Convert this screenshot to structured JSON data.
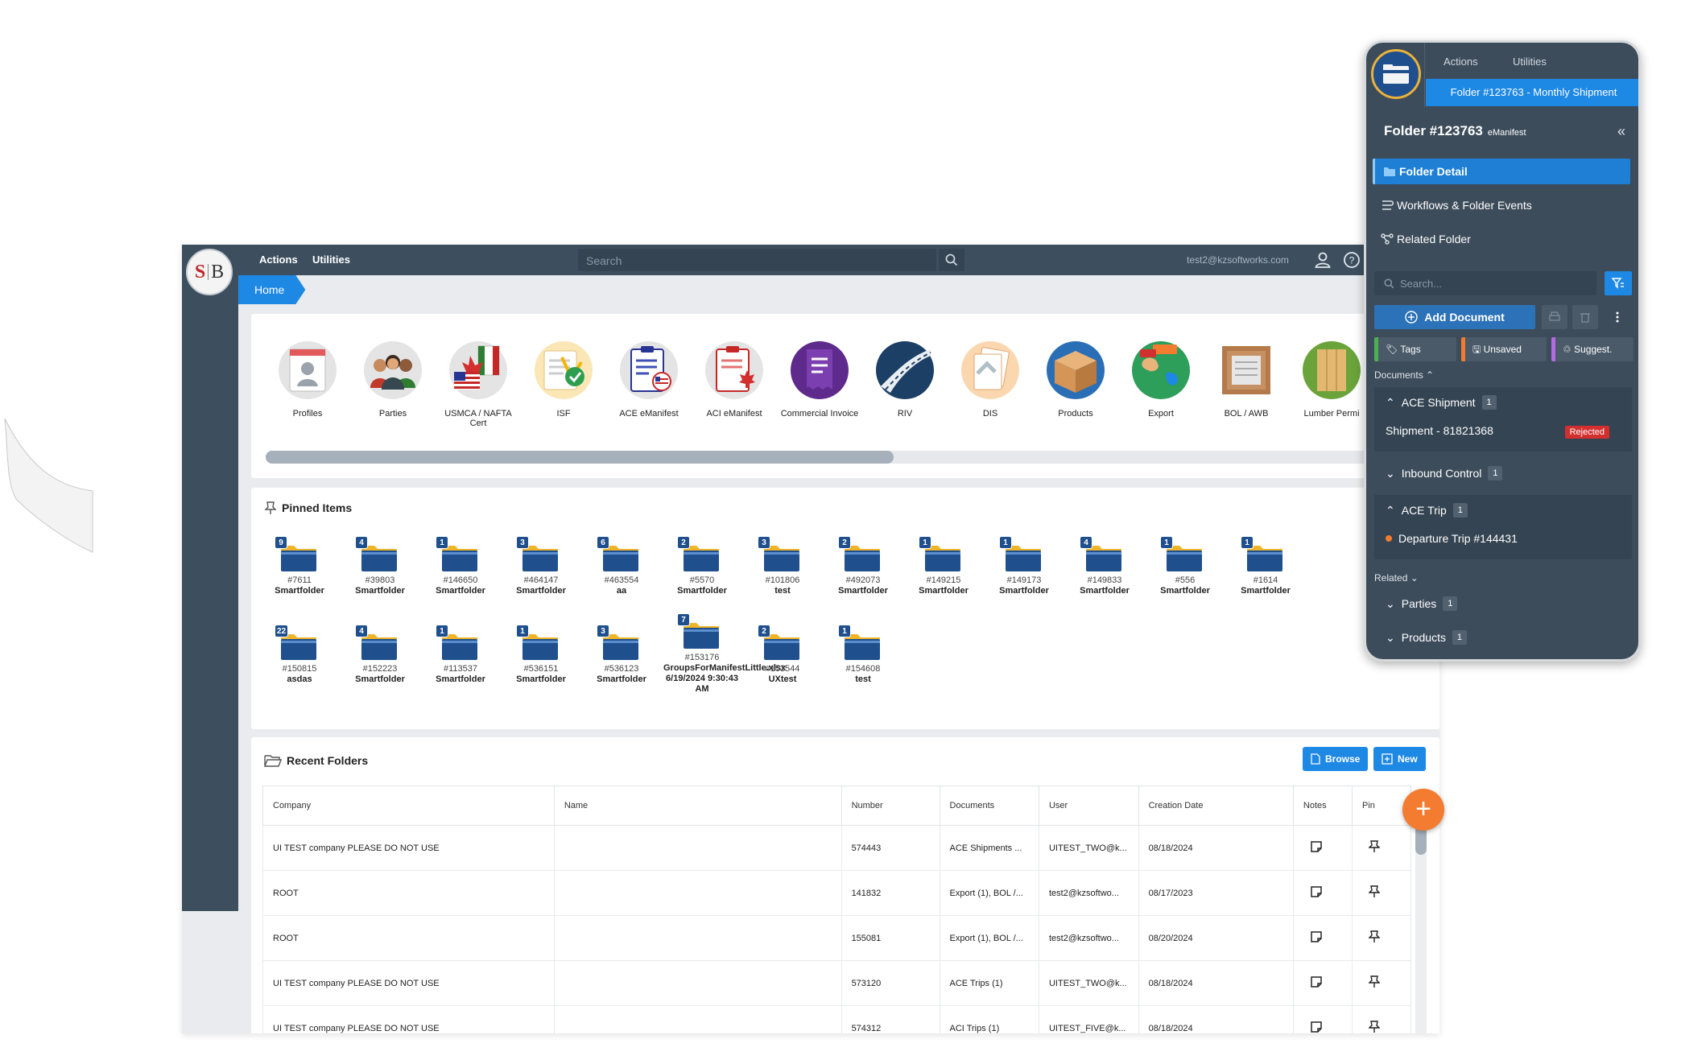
{
  "topbar": {
    "actions_label": "Actions",
    "utilities_label": "Utilities",
    "search_placeholder": "Search",
    "user_email": "test2@kzsoftworks.com"
  },
  "breadcrumb": {
    "home_label": "Home"
  },
  "modules": [
    {
      "label": "Profiles",
      "icon": "profile-card-icon"
    },
    {
      "label": "Parties",
      "icon": "people-group-icon"
    },
    {
      "label": "USMCA / NAFTA Cert",
      "icon": "flags-certificate-icon"
    },
    {
      "label": "ISF",
      "icon": "checked-document-icon"
    },
    {
      "label": "ACE eManifest",
      "icon": "us-manifest-icon"
    },
    {
      "label": "ACI eManifest",
      "icon": "canada-manifest-icon"
    },
    {
      "label": "Commercial Invoice",
      "icon": "invoice-icon"
    },
    {
      "label": "RIV",
      "icon": "road-icon"
    },
    {
      "label": "DIS",
      "icon": "documents-stack-icon"
    },
    {
      "label": "Products",
      "icon": "box-icon"
    },
    {
      "label": "Export",
      "icon": "globe-icon"
    },
    {
      "label": "BOL / AWB",
      "icon": "crate-icon"
    },
    {
      "label": "Lumber Permi",
      "icon": "lumber-icon"
    }
  ],
  "pinned": {
    "title": "Pinned Items",
    "items": [
      {
        "badge": "9",
        "number": "#7611",
        "name": "Smartfolder"
      },
      {
        "badge": "4",
        "number": "#39803",
        "name": "Smartfolder"
      },
      {
        "badge": "1",
        "number": "#146650",
        "name": "Smartfolder"
      },
      {
        "badge": "3",
        "number": "#464147",
        "name": "Smartfolder"
      },
      {
        "badge": "6",
        "number": "#463554",
        "name": "aa"
      },
      {
        "badge": "2",
        "number": "#5570",
        "name": "Smartfolder"
      },
      {
        "badge": "3",
        "number": "#101806",
        "name": "test"
      },
      {
        "badge": "2",
        "number": "#492073",
        "name": "Smartfolder"
      },
      {
        "badge": "1",
        "number": "#149215",
        "name": "Smartfolder"
      },
      {
        "badge": "1",
        "number": "#149173",
        "name": "Smartfolder"
      },
      {
        "badge": "4",
        "number": "#149833",
        "name": "Smartfolder"
      },
      {
        "badge": "1",
        "number": "#556",
        "name": "Smartfolder"
      },
      {
        "badge": "1",
        "number": "#1614",
        "name": "Smartfolder"
      },
      {
        "badge": "22",
        "number": "#150815",
        "name": "asdas"
      },
      {
        "badge": "4",
        "number": "#152223",
        "name": "Smartfolder"
      },
      {
        "badge": "1",
        "number": "#113537",
        "name": "Smartfolder"
      },
      {
        "badge": "1",
        "number": "#536151",
        "name": "Smartfolder"
      },
      {
        "badge": "3",
        "number": "#536123",
        "name": "Smartfolder"
      },
      {
        "badge": "7",
        "number": "#153176",
        "name": "GroupsForManifestLittle.xlsx 6/19/2024 9:30:43 AM"
      },
      {
        "badge": "2",
        "number": "#153544",
        "name": "UXtest"
      },
      {
        "badge": "1",
        "number": "#154608",
        "name": "test"
      }
    ]
  },
  "recent": {
    "title": "Recent Folders",
    "browse_label": "Browse",
    "new_label": "New",
    "columns": [
      "Company",
      "Name",
      "Number",
      "Documents",
      "User",
      "Creation Date",
      "Notes",
      "Pin"
    ],
    "rows": [
      [
        "UI TEST company PLEASE DO NOT USE",
        "",
        "574443",
        "ACE Shipments ...",
        "UITEST_TWO@k...",
        "08/18/2024"
      ],
      [
        "ROOT",
        "",
        "141832",
        "Export (1), BOL /...",
        "test2@kzsoftwo...",
        "08/17/2023"
      ],
      [
        "ROOT",
        "",
        "155081",
        "Export (1), BOL /...",
        "test2@kzsoftwo...",
        "08/20/2024"
      ],
      [
        "UI TEST company PLEASE DO NOT USE",
        "",
        "573120",
        "ACE Trips (1)",
        "UITEST_TWO@k...",
        "08/18/2024"
      ],
      [
        "UI TEST company PLEASE DO NOT USE",
        "",
        "574312",
        "ACI Trips (1)",
        "UITEST_FIVE@k...",
        "08/18/2024"
      ]
    ]
  },
  "fab_label": "+",
  "side_panel": {
    "actions_label": "Actions",
    "utilities_label": "Utilities",
    "active_tab": "Folder #123763 - Monthly Shipment",
    "folder_title": "Folder #123763",
    "folder_subtitle": "eManifest",
    "collapse_glyph": "«",
    "nav": [
      "Folder Detail",
      "Workflows & Folder Events",
      "Related Folder"
    ],
    "search_placeholder": "Search...",
    "add_document_label": "Add Document",
    "chips": [
      {
        "label": "Tags",
        "color": "#4caf50"
      },
      {
        "label": "Unsaved",
        "color": "#f47c30"
      },
      {
        "label": "Suggest.",
        "color": "#b36ae2"
      }
    ],
    "documents_label": "Documents",
    "groups": [
      {
        "name": "ACE Shipment",
        "count": "1",
        "item": "Shipment - 81821368",
        "status": "Rejected"
      },
      {
        "name": "Inbound Control",
        "count": "1"
      },
      {
        "name": "ACE Trip",
        "count": "1",
        "item": "Departure Trip #144431"
      }
    ],
    "related_label": "Related",
    "related": [
      {
        "name": "Parties",
        "count": "1"
      },
      {
        "name": "Products",
        "count": "1"
      }
    ]
  }
}
